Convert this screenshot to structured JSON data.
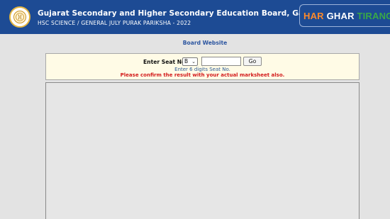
{
  "header": {
    "title": "Gujarat Secondary and Higher Secondary Education Board, Gandhinagar",
    "subtitle": "HSC SCIENCE / GENERAL JULY PURAK PARIKSHA - 2022"
  },
  "banner": {
    "word1": "HAR",
    "word2": "GHAR",
    "word3": "TIRANG"
  },
  "board_link": "Board Website",
  "form": {
    "seat_label": "Enter Seat No :",
    "series_value": "B",
    "seat_value": "",
    "go_label": "Go",
    "hint": "Enter 6 digits Seat No.",
    "warning": "Please confirm the result with your actual marksheet also."
  },
  "colors": {
    "header_bg": "#1d4b94",
    "page_bg": "#e3e3e3",
    "form_bg": "#fffbe6",
    "warning": "#d31b1b",
    "hint": "#2e5d9a"
  }
}
